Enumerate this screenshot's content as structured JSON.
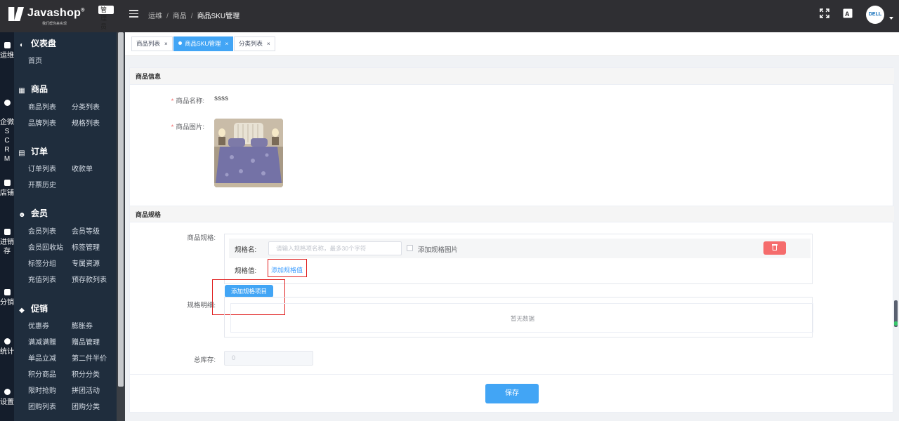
{
  "app": {
    "logo_text": "Javashop",
    "logo_registered": "®",
    "logo_sub": "我们帮你来实现",
    "admin_badge": "管理员"
  },
  "breadcrumb": [
    "运维",
    "商品",
    "商品SKU管理"
  ],
  "breadcrumb_sep": "/",
  "avatar_text": "DELL",
  "rail": [
    {
      "icon": "ops-icon",
      "label": "运维"
    },
    {
      "icon": "wechat-icon",
      "label": "企微\nS\nC\nR\nM"
    },
    {
      "icon": "store-icon",
      "label": "店铺"
    },
    {
      "icon": "inventory-icon",
      "label": "进销存"
    },
    {
      "icon": "distribution-icon",
      "label": "分销"
    },
    {
      "icon": "stats-icon",
      "label": "统计"
    },
    {
      "icon": "settings-icon",
      "label": "设置"
    }
  ],
  "sidebar": {
    "dashboard": {
      "title": "仪表盘",
      "items": [
        "首页"
      ]
    },
    "goods": {
      "title": "商品",
      "items": [
        "商品列表",
        "分类列表",
        "品牌列表",
        "规格列表"
      ]
    },
    "order": {
      "title": "订单",
      "items": [
        "订单列表",
        "收款单",
        "开票历史"
      ]
    },
    "member": {
      "title": "会员",
      "items": [
        "会员列表",
        "会员等级",
        "会员回收站",
        "标签管理",
        "标签分组",
        "专属资源",
        "充值列表",
        "预存款列表"
      ]
    },
    "promo": {
      "title": "促销",
      "items": [
        "优惠券",
        "膨胀券",
        "满减满赠",
        "赠品管理",
        "单品立减",
        "第二件半价",
        "积分商品",
        "积分分类",
        "限时抢购",
        "拼团活动",
        "团购列表",
        "团购分类"
      ]
    }
  },
  "tabs": [
    {
      "label": "商品列表",
      "active": false
    },
    {
      "label": "商品SKU管理",
      "active": true
    },
    {
      "label": "分类列表",
      "active": false
    }
  ],
  "tab_close": "×",
  "goods_info": {
    "section_title": "商品信息",
    "name_label": "商品名称:",
    "name_value": "ssss",
    "image_label": "商品图片:",
    "required_mark": "*"
  },
  "goods_spec": {
    "section_title": "商品规格",
    "spec_label": "商品规格:",
    "spec_name_label": "规格名:",
    "spec_name_placeholder": "请输入规格项名称，最多30个字符",
    "spec_image_checkbox": "添加规格图片",
    "spec_image_checked": false,
    "spec_value_label": "规格值:",
    "add_spec_value": "添加规格值",
    "add_spec_item": "添加规格项目",
    "detail_label": "规格明细:",
    "empty_text": "暂无数据",
    "stock_label": "总库存:",
    "stock_value": "0"
  },
  "save_button": "保存",
  "colors": {
    "primary": "#42a5f5",
    "danger": "#f56c6c",
    "link": "#409eff",
    "sidebar_bg": "#1f2d3d",
    "topbar_bg": "#2f2f33",
    "highlight_box": "#e02020"
  }
}
